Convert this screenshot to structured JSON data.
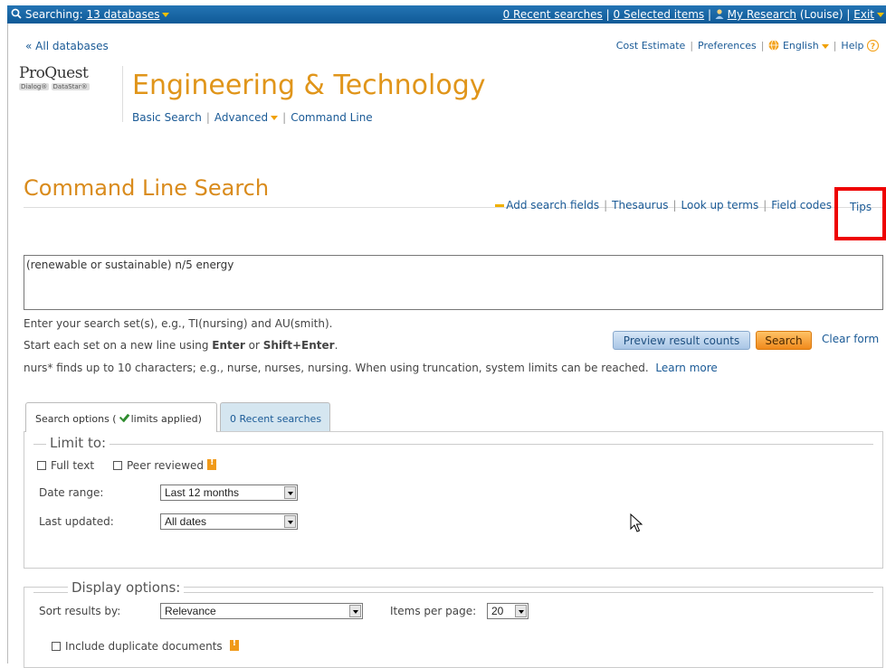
{
  "topbar": {
    "searching_prefix": "Searching:",
    "databases_link": "13 databases",
    "recent_searches": "0 Recent searches",
    "selected_items": "0 Selected items",
    "my_research": "My Research",
    "user": "(Louise)",
    "exit": "Exit"
  },
  "nav": {
    "all_databases": "« All databases",
    "cost_estimate": "Cost Estimate",
    "preferences": "Preferences",
    "language": "English",
    "help": "Help"
  },
  "brand": {
    "logo_main": "ProQuest",
    "logo_sub1": "Dialog®",
    "logo_sub2": "DataStar®",
    "app_title": "Engineering & Technology"
  },
  "modes": {
    "basic": "Basic Search",
    "advanced": "Advanced",
    "command": "Command Line"
  },
  "page_title": "Command Line Search",
  "tools": {
    "add_fields": "Add search fields",
    "thesaurus": "Thesaurus",
    "look_up": "Look up terms",
    "field_codes": "Field codes",
    "tips": "Tips"
  },
  "query": {
    "value": "(renewable or sustainable) n/5 energy"
  },
  "help": {
    "line1": "Enter your search set(s), e.g., TI(nursing) and AU(smith).",
    "line2_pre": "Start each set on a new line using ",
    "line2_enter": "Enter",
    "line2_or": " or ",
    "line2_shift": "Shift+Enter",
    "line2_post": ".",
    "line3": "nurs* finds up to 10 characters; e.g., nurse, nurses, nursing. When using truncation, system limits can be reached.",
    "learn_more": "Learn more"
  },
  "buttons": {
    "preview": "Preview result counts",
    "search": "Search",
    "clear": "Clear form"
  },
  "tabs": {
    "options_pre": "Search options (",
    "options_post": "limits applied)",
    "recent": "0 Recent searches"
  },
  "limits": {
    "legend": "Limit to:",
    "full_text": "Full text",
    "peer_reviewed": "Peer reviewed",
    "date_range_label": "Date range:",
    "date_range_value": "Last 12 months",
    "last_updated_label": "Last updated:",
    "last_updated_value": "All dates"
  },
  "display": {
    "legend": "Display options:",
    "sort_label": "Sort results by:",
    "sort_value": "Relevance",
    "items_label": "Items per page:",
    "items_value": "20",
    "duplicates": "Include duplicate documents"
  }
}
